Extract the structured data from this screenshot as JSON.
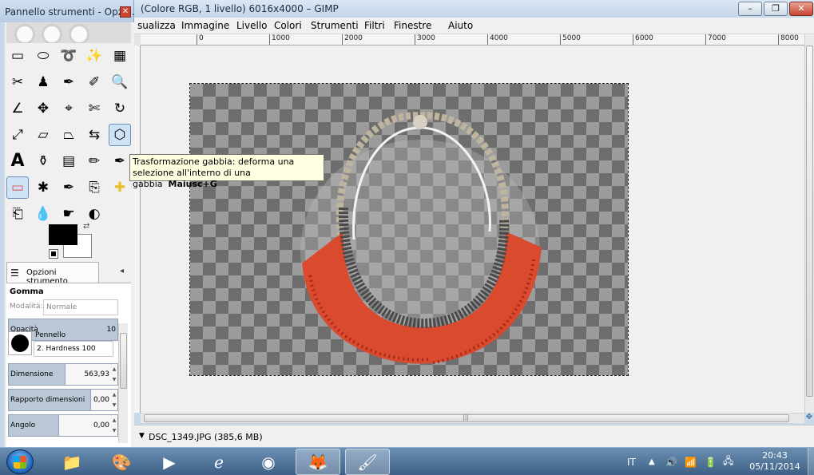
{
  "main_window": {
    "title": "(Colore RGB, 1 livello) 6016x4000 – GIMP",
    "buttons": {
      "minimize": "–",
      "restore": "❐",
      "close": "✕"
    },
    "menu": [
      "sualizza",
      "Immagine",
      "Livello",
      "Colori",
      "Strumenti",
      "Filtri",
      "Finestre",
      "Aiuto"
    ],
    "ruler_ticks": [
      "0",
      "1000",
      "2000",
      "3000",
      "4000",
      "5000",
      "6000",
      "7000",
      "8000"
    ],
    "status_file": "DSC_1349.JPG (385,6 MB)",
    "hscroll_grip": "|||"
  },
  "toolbox": {
    "title": "Pannello strumenti - Opzi...",
    "close": "✕",
    "tools": [
      {
        "icon": "rect-select-icon",
        "glyph": "▭"
      },
      {
        "icon": "ellipse-select-icon",
        "glyph": "⬭"
      },
      {
        "icon": "free-select-icon",
        "glyph": "➰"
      },
      {
        "icon": "fuzzy-select-icon",
        "glyph": "✨"
      },
      {
        "icon": "color-select-icon",
        "glyph": "▦"
      },
      {
        "icon": "scissors-select-icon",
        "glyph": "✂"
      },
      {
        "icon": "foreground-select-icon",
        "glyph": "♟"
      },
      {
        "icon": "paths-icon",
        "glyph": "✒"
      },
      {
        "icon": "color-picker-icon",
        "glyph": "✐"
      },
      {
        "icon": "zoom-icon",
        "glyph": "🔍"
      },
      {
        "icon": "measure-icon",
        "glyph": "∠"
      },
      {
        "icon": "move-icon",
        "glyph": "✥"
      },
      {
        "icon": "align-icon",
        "glyph": "⌖"
      },
      {
        "icon": "crop-icon",
        "glyph": "✄"
      },
      {
        "icon": "rotate-icon",
        "glyph": "↻"
      },
      {
        "icon": "scale-icon",
        "glyph": "⤢"
      },
      {
        "icon": "shear-icon",
        "glyph": "▱"
      },
      {
        "icon": "perspective-icon",
        "glyph": "⏢"
      },
      {
        "icon": "flip-icon",
        "glyph": "⇆"
      },
      {
        "icon": "cage-transform-icon",
        "glyph": "⬡"
      },
      {
        "icon": "text-icon",
        "glyph": "A"
      },
      {
        "icon": "bucket-fill-icon",
        "glyph": "⚱"
      },
      {
        "icon": "blend-icon",
        "glyph": "▤"
      },
      {
        "icon": "pencil-icon",
        "glyph": "✏"
      },
      {
        "icon": "paintbrush-icon",
        "glyph": "✒"
      },
      {
        "icon": "eraser-icon",
        "glyph": "▭"
      },
      {
        "icon": "airbrush-icon",
        "glyph": "✱"
      },
      {
        "icon": "ink-icon",
        "glyph": "✒"
      },
      {
        "icon": "clone-icon",
        "glyph": "⎘"
      },
      {
        "icon": "heal-icon",
        "glyph": "✚"
      },
      {
        "icon": "perspective-clone-icon",
        "glyph": "⎗"
      },
      {
        "icon": "blur-icon",
        "glyph": "💧"
      },
      {
        "icon": "smudge-icon",
        "glyph": "☛"
      },
      {
        "icon": "dodge-burn-icon",
        "glyph": "◐"
      }
    ],
    "options_tab_label": "Opzioni strumento",
    "tool_name": "Gomma",
    "mode_label": "Modalità:",
    "mode_value": "Normale",
    "opacity_label": "Opacità",
    "opacity_value": "10",
    "brush_label": "Pennello",
    "brush_name": "2. Hardness 100",
    "size_label": "Dimensione",
    "size_value": "563,93",
    "ratio_label": "Rapporto dimensioni",
    "ratio_value": "0,00",
    "angle_label": "Angolo",
    "angle_value": "0,00"
  },
  "tooltip": {
    "line1": "Trasformazione gabbia: deforma una",
    "line2": "selezione all'interno di una gabbia",
    "shortcut": "Maiusc+G"
  },
  "taskbar": {
    "language": "IT",
    "time": "20:43",
    "date": "05/11/2014"
  },
  "colors": {
    "tooltip_bg": "#ffffe1",
    "beads": "#d94a2e",
    "taskbar": "#4a6d93"
  }
}
